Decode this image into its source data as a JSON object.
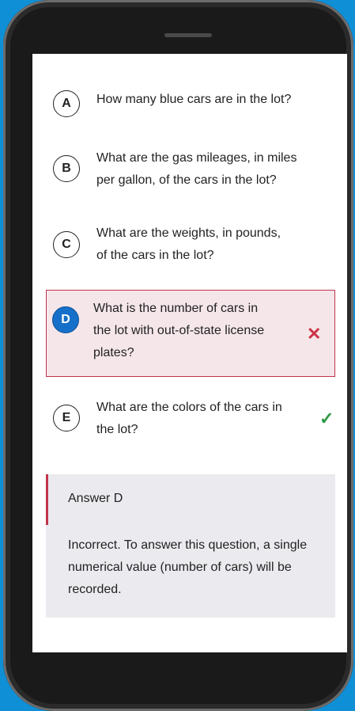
{
  "options": [
    {
      "letter": "A",
      "text": "How many blue cars are in the lot?"
    },
    {
      "letter": "B",
      "text_line1": "What are the gas mileages, in miles",
      "text_line2": "per gallon, of the cars in the lot?"
    },
    {
      "letter": "C",
      "text_line1": "What are the weights, in pounds,",
      "text_line2": "of the cars in the lot?"
    },
    {
      "letter": "D",
      "text_line1": "What is the number of cars in",
      "text_line2": "the lot with out-of-state license",
      "text_line3": "plates?",
      "state": "selected-incorrect",
      "mark_icon": "x-icon"
    },
    {
      "letter": "E",
      "text_line1": "What are the colors of the cars in",
      "text_line2": "the lot?",
      "state": "correct",
      "mark_icon": "check-icon"
    }
  ],
  "marks": {
    "incorrect": "✕",
    "correct": "✓"
  },
  "feedback": {
    "title": "Answer D",
    "body": "Incorrect. To answer this question, a single numerical value (number of cars) will be recorded."
  },
  "colors": {
    "background": "#0f8fd6",
    "selected": "#1670c9",
    "incorrect": "#c0344a",
    "correct": "#2e9a45"
  }
}
